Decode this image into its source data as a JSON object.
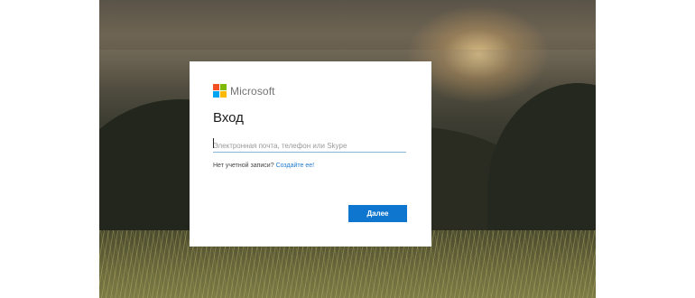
{
  "brand": {
    "name": "Microsoft",
    "logo_colors": [
      "#f25022",
      "#7fba00",
      "#00a4ef",
      "#ffb900"
    ]
  },
  "signin": {
    "title": "Вход",
    "email_placeholder": "Электронная почта, телефон или Skype",
    "email_value": "",
    "no_account_text": "Нет учетной записи?",
    "create_link": "Создайте ее!",
    "next_button": "Далее"
  },
  "colors": {
    "accent": "#0f76cf",
    "link": "#1f7bd0"
  }
}
